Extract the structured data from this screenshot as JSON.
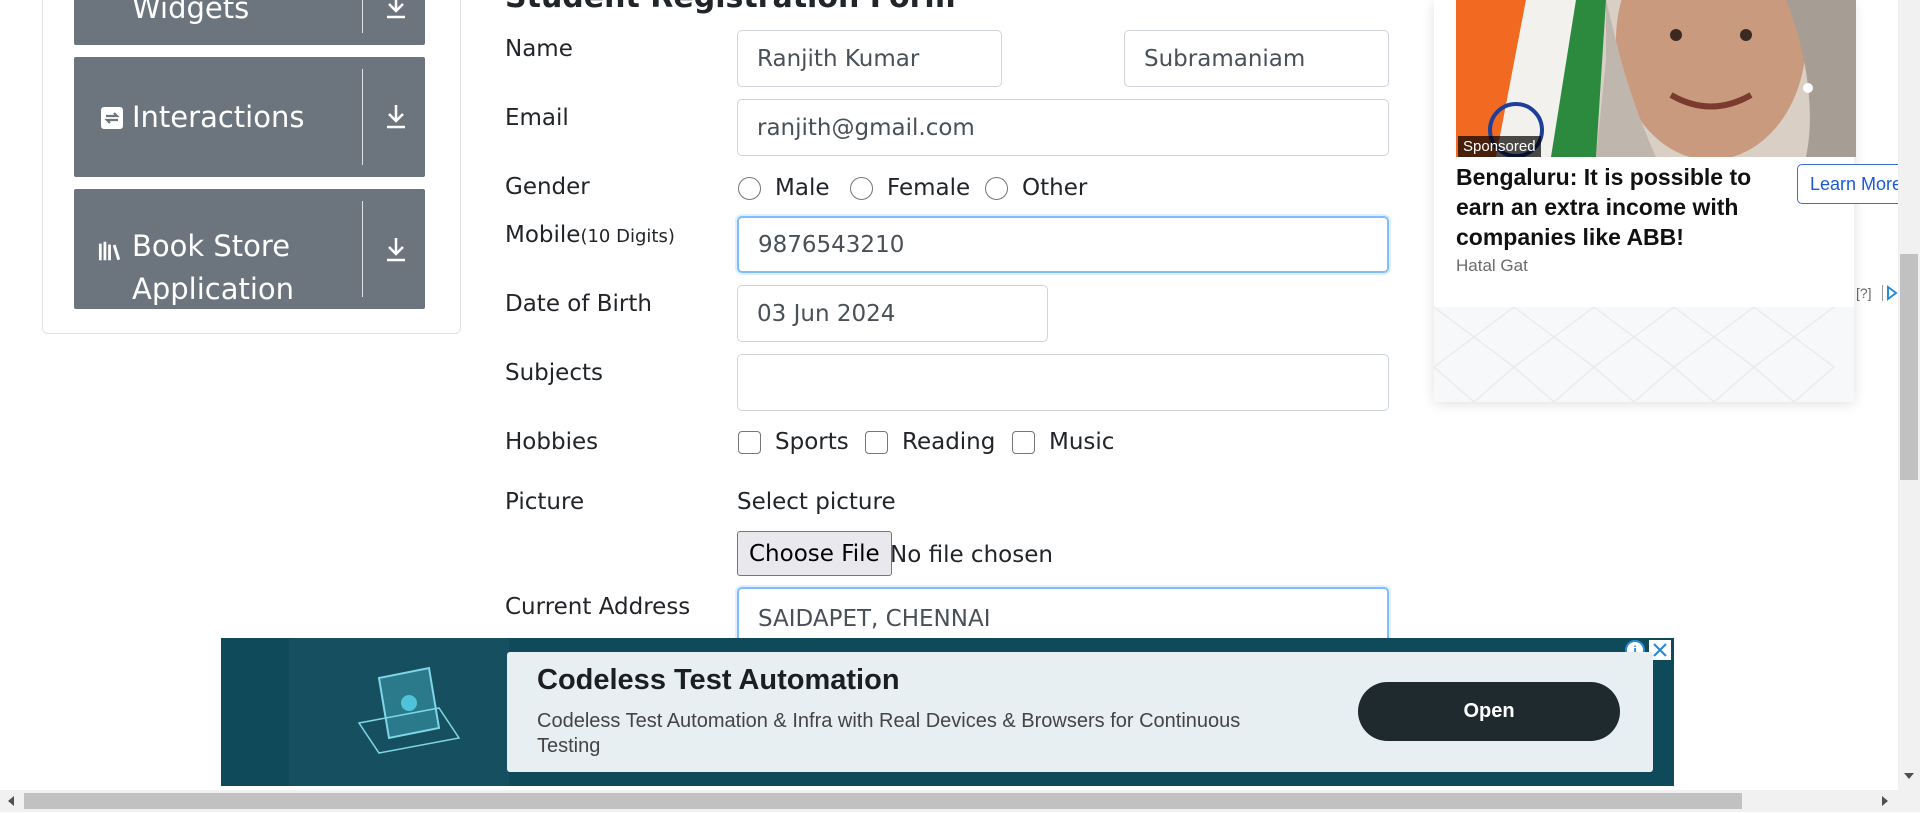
{
  "sidebar": {
    "items": [
      {
        "label": "Widgets",
        "icon": "widgets-icon"
      },
      {
        "label": "Interactions",
        "icon": "interactions-icon"
      },
      {
        "label": "Book Store Application",
        "label_line1": "Book Store",
        "label_line2": "Application",
        "icon": "book-store-icon"
      }
    ]
  },
  "form": {
    "title": "Student Registration Form",
    "name": {
      "label": "Name",
      "first_name": "Ranjith Kumar",
      "last_name": "Subramaniam"
    },
    "email": {
      "label": "Email",
      "value": "ranjith@gmail.com"
    },
    "gender": {
      "label": "Gender",
      "options": [
        "Male",
        "Female",
        "Other"
      ]
    },
    "mobile": {
      "label": "Mobile",
      "hint": "(10 Digits)",
      "value": "9876543210"
    },
    "dob": {
      "label": "Date of Birth",
      "value": "03 Jun 2024"
    },
    "subjects": {
      "label": "Subjects",
      "value": ""
    },
    "hobbies": {
      "label": "Hobbies",
      "options": [
        "Sports",
        "Reading",
        "Music"
      ]
    },
    "picture": {
      "label": "Picture",
      "prompt": "Select picture",
      "button": "Choose File",
      "status": "No file chosen"
    },
    "address": {
      "label": "Current Address",
      "value": "SAIDAPET, CHENNAI"
    }
  },
  "side_ad": {
    "badge": "Sponsored",
    "headline": "Bengaluru: It is possible to earn an extra income with companies like ABB!",
    "source": "Hatal Gat",
    "cta": "Learn More",
    "info": "[?]"
  },
  "bottom_ad": {
    "title": "Codeless Test Automation",
    "description": "Codeless Test Automation & Infra with Real Devices & Browsers for Continuous Testing",
    "cta": "Open"
  },
  "colors": {
    "sidebar_item": "#6c757d",
    "focus_border": "#80bdff",
    "ad_background": "#0e4a5a",
    "learn_more": "#1a5ad8"
  }
}
